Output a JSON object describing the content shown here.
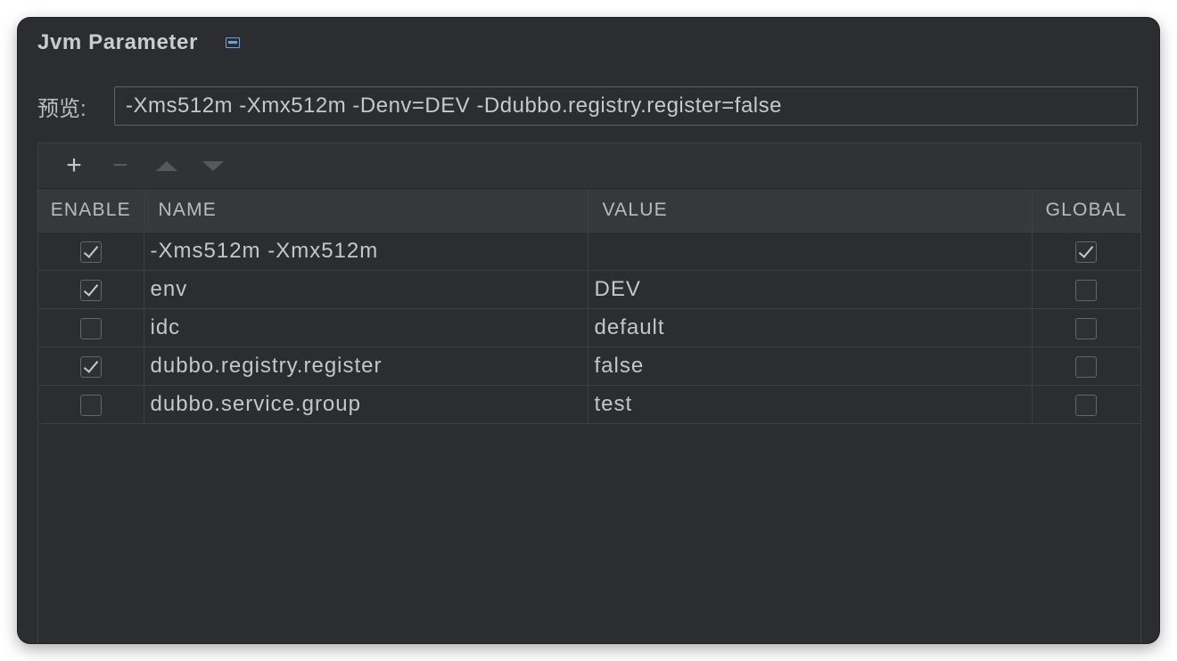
{
  "window": {
    "title": "Jvm Parameter"
  },
  "preview": {
    "label": "预览:",
    "value": "-Xms512m -Xmx512m -Denv=DEV -Ddubbo.registry.register=false"
  },
  "toolbar": {
    "add_icon": "plus-icon",
    "remove_icon": "minus-icon",
    "up_icon": "arrow-up-icon",
    "down_icon": "arrow-down-icon",
    "add_label": "+",
    "remove_label": "−"
  },
  "table": {
    "columns": [
      "ENABLE",
      "NAME",
      "VALUE",
      "GLOBAL"
    ],
    "rows": [
      {
        "enable": true,
        "name": "-Xms512m -Xmx512m",
        "value": "",
        "global": true
      },
      {
        "enable": true,
        "name": "env",
        "value": "DEV",
        "global": false
      },
      {
        "enable": false,
        "name": "idc",
        "value": "default",
        "global": false
      },
      {
        "enable": true,
        "name": "dubbo.registry.register",
        "value": "false",
        "global": false
      },
      {
        "enable": false,
        "name": "dubbo.service.group",
        "value": "test",
        "global": false
      }
    ]
  },
  "colors": {
    "background": "#2b2d30",
    "accent": "#6fa0d8",
    "text": "#c4c6ca"
  }
}
